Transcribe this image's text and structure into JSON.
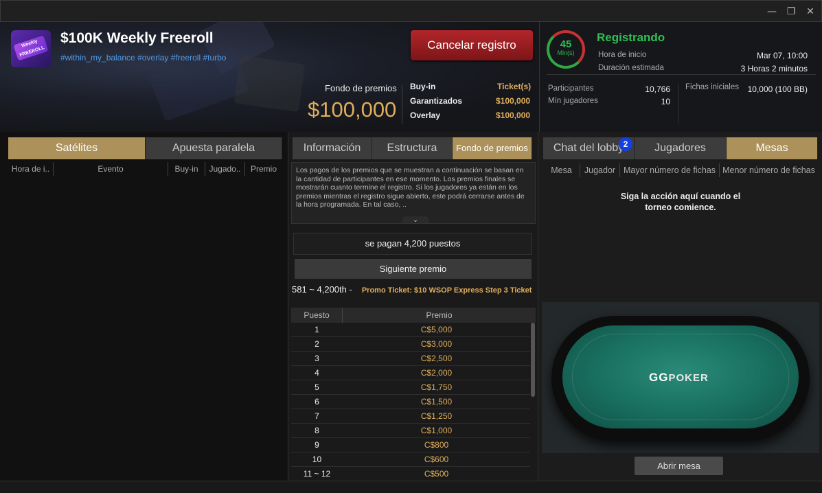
{
  "window": {
    "minimize_icon": "minimize-icon",
    "restore_icon": "restore-icon",
    "close_icon": "close-icon"
  },
  "tournament": {
    "logo_text": "Weekly FREEROLL",
    "title": "$100K Weekly Freeroll",
    "tags": "#within_my_balance #overlay #freeroll #turbo",
    "cancel_label": "Cancelar registro",
    "prize_label": "Fondo de premios",
    "prize_amount": "$100,000",
    "buyin_label": "Buy-in",
    "buyin_value": "Ticket(s)",
    "guaranteed_label": "Garantizados",
    "guaranteed_value": "$100,000",
    "overlay_label": "Overlay",
    "overlay_value": "$100,000"
  },
  "status": {
    "timer_value": "45",
    "timer_unit": "Min(s)",
    "state": "Registrando",
    "start_label": "Hora de inicio",
    "start_value": "Mar 07, 10:00",
    "duration_label": "Duración estimada",
    "duration_value": "3 Horas 2 minutos",
    "participants_label": "Participantes",
    "participants_value": "10,766",
    "min_players_label": "Mín jugadores",
    "min_players_value": "10",
    "chips_label": "Fichas iniciales",
    "chips_value": "10,000 (100 BB)"
  },
  "left": {
    "tabs": [
      "Satélites",
      "Apuesta paralela"
    ],
    "columns": [
      "Hora de i..",
      "Evento",
      "Buy-in",
      "Jugado..",
      "Premio"
    ]
  },
  "middle": {
    "tabs": [
      "Información",
      "Estructura",
      "Fondo de premios"
    ],
    "info_text": "Los pagos de los premios que se muestran a continuación se basan en la cantidad de participantes en ese momento. Los premios finales se mostrarán cuanto termine el registro. Si los jugadores ya están en los premios mientras el registro sigue abierto, este podrá cerrarse antes de la hora programada. En tal caso, ..",
    "expand_icon": "chevron-down-icon",
    "paid_text": "se pagan 4,200 puestos",
    "next_prize_label": "Siguiente premio",
    "next_range": "581 ~ 4,200th  -",
    "next_prize_value": "Promo Ticket: $10 WSOP Express Step 3 Ticket",
    "table_headers": [
      "Puesto",
      "Premio"
    ],
    "prizes": [
      {
        "place": "1",
        "prize": "C$5,000"
      },
      {
        "place": "2",
        "prize": "C$3,000"
      },
      {
        "place": "3",
        "prize": "C$2,500"
      },
      {
        "place": "4",
        "prize": "C$2,000"
      },
      {
        "place": "5",
        "prize": "C$1,750"
      },
      {
        "place": "6",
        "prize": "C$1,500"
      },
      {
        "place": "7",
        "prize": "C$1,250"
      },
      {
        "place": "8",
        "prize": "C$1,000"
      },
      {
        "place": "9",
        "prize": "C$800"
      },
      {
        "place": "10",
        "prize": "C$600"
      },
      {
        "place": "11 ~ 12",
        "prize": "C$500"
      }
    ]
  },
  "right": {
    "tabs": [
      "Chat del lobby",
      "Jugadores",
      "Mesas"
    ],
    "chat_badge": "2",
    "columns": [
      "Mesa",
      "Jugador",
      "Mayor número de fichas",
      "Menor número de fichas"
    ],
    "message_line1": "Siga la acción aquí cuando el",
    "message_line2": "torneo comience.",
    "table_logo_gg": "GG",
    "table_logo_text": "POKER",
    "open_table_label": "Abrir mesa"
  },
  "colors": {
    "accent_gold": "#e0ad5c",
    "active_tab": "#ac915b",
    "status_green": "#2fbf55",
    "cancel_red": "#b3262a"
  }
}
